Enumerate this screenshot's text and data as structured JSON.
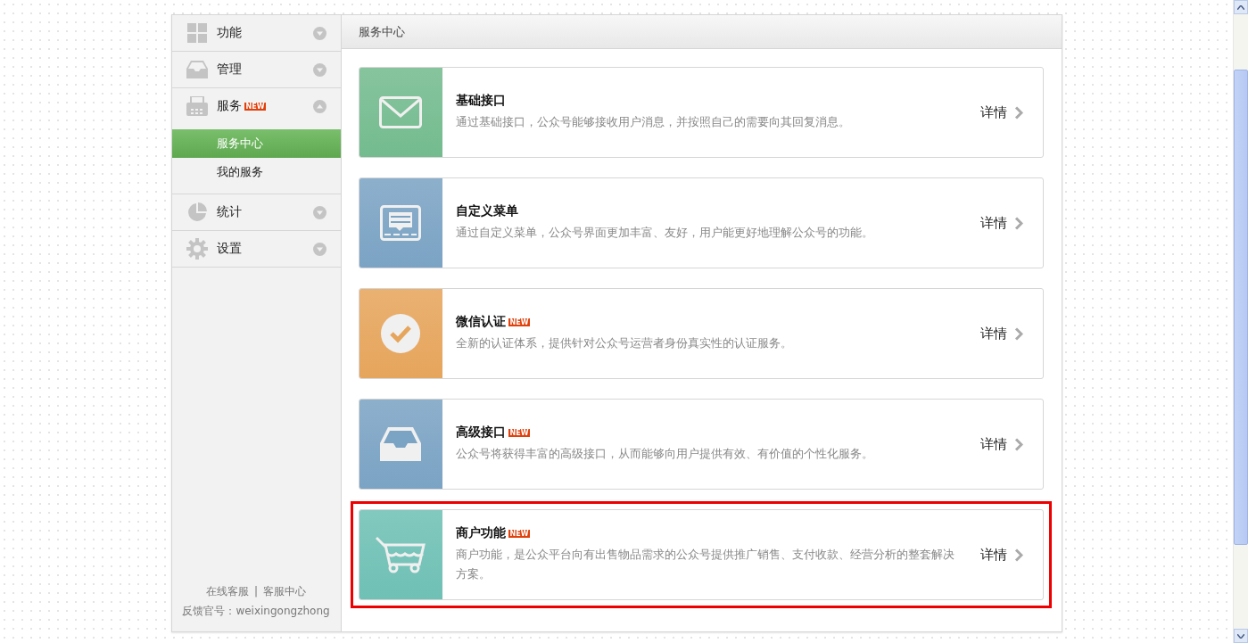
{
  "sidebar": {
    "items": [
      {
        "label": "功能",
        "expanded": false
      },
      {
        "label": "管理",
        "expanded": false
      },
      {
        "label": "服务",
        "badge": "NEW",
        "expanded": true,
        "children": [
          {
            "label": "服务中心",
            "selected": true
          },
          {
            "label": "我的服务",
            "selected": false
          }
        ]
      },
      {
        "label": "统计",
        "expanded": false
      },
      {
        "label": "设置",
        "expanded": false
      }
    ],
    "footer": {
      "links": [
        "在线客服",
        "客服中心"
      ],
      "separator": "|",
      "contact": "反馈官号：weixingongzhong"
    }
  },
  "main": {
    "title": "服务中心",
    "cards": [
      {
        "title": "基础接口",
        "description": "通过基础接口，公众号能够接收用户消息，并按照自己的需要向其回复消息。",
        "details": "详情",
        "color": "#74bb8f",
        "highlighted": false
      },
      {
        "title": "自定义菜单",
        "description": "通过自定义菜单，公众号界面更加丰富、友好，用户能更好地理解公众号的功能。",
        "details": "详情",
        "color": "#7ba3c4",
        "highlighted": false
      },
      {
        "title": "微信认证",
        "badge": "NEW",
        "description": "全新的认证体系，提供针对公众号运营者身份真实性的认证服务。",
        "details": "详情",
        "color": "#e6a55c",
        "highlighted": false
      },
      {
        "title": "高级接口",
        "badge": "NEW",
        "description": "公众号将获得丰富的高级接口，从而能够向用户提供有效、有价值的个性化服务。",
        "details": "详情",
        "color": "#7ba3c4",
        "highlighted": false
      },
      {
        "title": "商户功能",
        "badge": "NEW",
        "description": "商户功能，是公众平台向有出售物品需求的公众号提供推广销售、支付收款、经营分析的整套解决方案。",
        "details": "详情",
        "color": "#6fc0b5",
        "highlighted": true
      }
    ]
  }
}
